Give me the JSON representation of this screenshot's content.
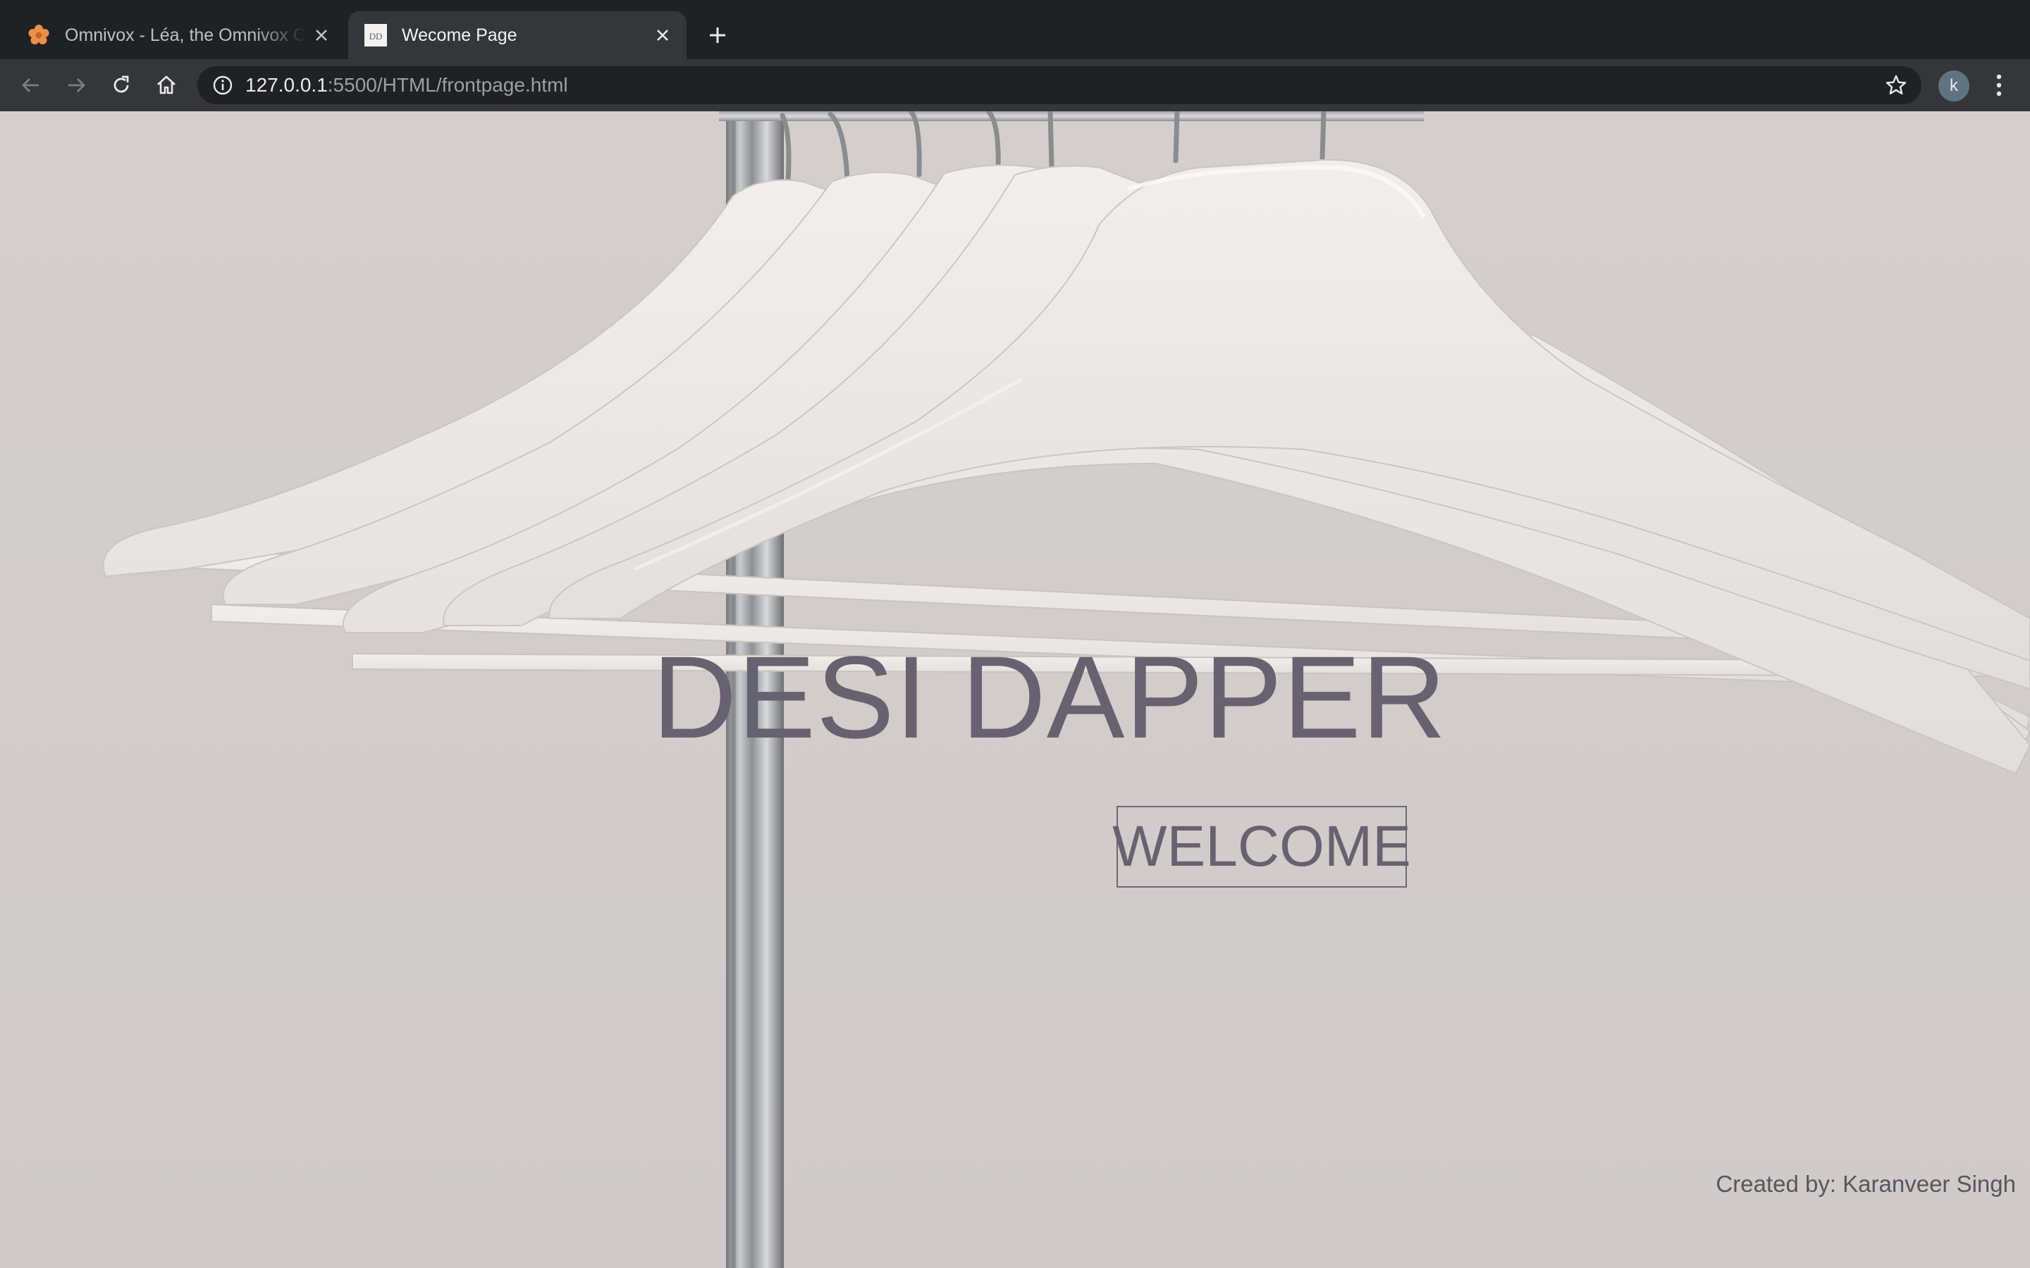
{
  "browser": {
    "tabs": [
      {
        "title": "Omnivox - Léa, the Omnivox Cl",
        "active": false,
        "favicon": "flower-icon"
      },
      {
        "title": "Wecome Page",
        "active": true,
        "favicon": "dd-logo-icon"
      }
    ],
    "address_bar": {
      "host": "127.0.0.1",
      "path": ":5500/HTML/frontpage.html"
    },
    "profile_initial": "k",
    "accent_color": "#e8914a"
  },
  "page": {
    "title": "DESI DAPPER",
    "welcome_button": "WELCOME",
    "credit": "Created by: Karanveer Singh",
    "text_color": "#66626f",
    "background_image": "white clothes hangers on chrome rack"
  }
}
